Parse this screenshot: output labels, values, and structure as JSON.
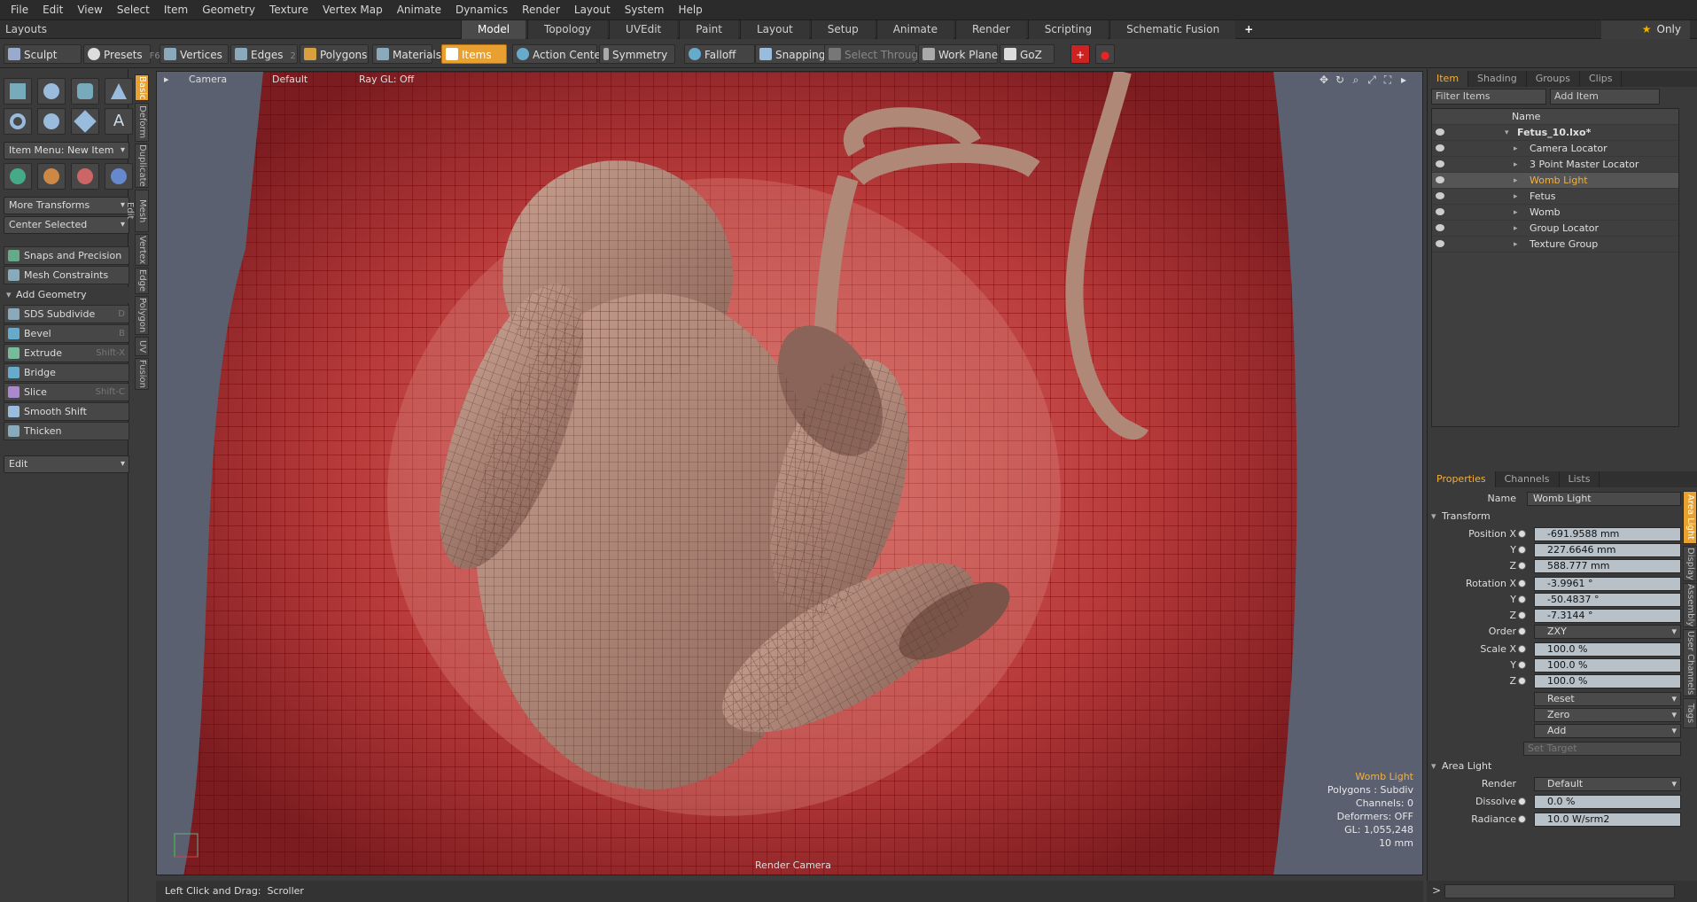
{
  "menu": [
    "File",
    "Edit",
    "View",
    "Select",
    "Item",
    "Geometry",
    "Texture",
    "Vertex Map",
    "Animate",
    "Dynamics",
    "Render",
    "Layout",
    "System",
    "Help"
  ],
  "layouts_label": "Layouts",
  "layout_tabs": [
    "Model",
    "Topology",
    "UVEdit",
    "Paint",
    "Layout",
    "Setup",
    "Animate",
    "Render",
    "Scripting",
    "Schematic Fusion"
  ],
  "add_tab": "+",
  "only_label": "Only",
  "toolbar": {
    "sculpt": "Sculpt",
    "presets": "Presets",
    "presets_key": "F6",
    "vertices": "Vertices",
    "vertices_key": "1",
    "edges": "Edges",
    "edges_key": "2",
    "polygons": "Polygons",
    "materials": "Materials",
    "items": "Items",
    "action_center": "Action Center",
    "symmetry": "Symmetry",
    "falloff": "Falloff",
    "snapping": "Snapping",
    "select_through": "Select Through",
    "work_plane": "Work Plane",
    "goz": "GoZ"
  },
  "left": {
    "item_menu": "Item Menu: New Item",
    "more_transforms": "More Transforms",
    "center_selected": "Center Selected",
    "snaps": "Snaps and Precision",
    "mesh_constraints": "Mesh Constraints",
    "add_geometry": "Add Geometry",
    "tools": [
      {
        "label": "SDS Subdivide",
        "key": "D"
      },
      {
        "label": "Bevel",
        "key": "B"
      },
      {
        "label": "Extrude",
        "key": "Shift-X"
      },
      {
        "label": "Bridge",
        "key": ""
      },
      {
        "label": "Slice",
        "key": "Shift-C"
      },
      {
        "label": "Smooth Shift",
        "key": ""
      },
      {
        "label": "Thicken",
        "key": ""
      }
    ],
    "edit_dd": "Edit"
  },
  "vtabs": [
    "Basic",
    "Deform",
    "Duplicate",
    "Mesh Edit",
    "Vertex",
    "Edge",
    "Polygon",
    "UV",
    "Fusion"
  ],
  "viewport": {
    "camera": "Camera",
    "shading": "Default",
    "raygl": "Ray GL: Off",
    "render_camera": "Render Camera",
    "info": {
      "name": "Womb Light",
      "polygons": "Polygons : Subdiv",
      "channels": "Channels: 0",
      "deformers": "Deformers: OFF",
      "gl": "GL: 1,055,248",
      "size": "10 mm"
    }
  },
  "right": {
    "tabs": [
      "Item",
      "Shading",
      "Groups",
      "Clips"
    ],
    "filter": "Filter Items",
    "add_item": "Add Item",
    "name_col": "Name",
    "items": [
      {
        "label": "Fetus_10.lxo*",
        "indent": 0,
        "bold": true,
        "sel": false
      },
      {
        "label": "Camera Locator",
        "indent": 1,
        "sel": false
      },
      {
        "label": "3 Point Master Locator",
        "indent": 1,
        "sel": false
      },
      {
        "label": "Womb Light",
        "indent": 1,
        "sel": true
      },
      {
        "label": "Fetus",
        "indent": 1,
        "sel": false
      },
      {
        "label": "Womb",
        "indent": 1,
        "sel": false
      },
      {
        "label": "Group Locator",
        "indent": 1,
        "sel": false
      },
      {
        "label": "Texture Group",
        "indent": 1,
        "sel": false
      }
    ],
    "prop_tabs": [
      "Properties",
      "Channels",
      "Lists"
    ],
    "props": {
      "name_lbl": "Name",
      "name_val": "Womb Light",
      "transform": "Transform",
      "pos_lbl": "Position X",
      "posx": "-691.9588 mm",
      "posy": "227.6646 mm",
      "posz": "588.777 mm",
      "rot_lbl": "Rotation X",
      "rotx": "-3.9961 °",
      "roty": "-50.4837 °",
      "rotz": "-7.3144 °",
      "order_lbl": "Order",
      "order": "ZXY",
      "scale_lbl": "Scale X",
      "sx": "100.0 %",
      "sy": "100.0 %",
      "sz": "100.0 %",
      "y": "Y",
      "z": "Z",
      "reset": "Reset",
      "zero": "Zero",
      "add": "Add",
      "set_target": "Set Target",
      "area_light": "Area Light",
      "render_lbl": "Render",
      "render": "Default",
      "dissolve_lbl": "Dissolve",
      "dissolve": "0.0 %",
      "radiance_lbl": "Radiance",
      "radiance": "10.0 W/srm2"
    },
    "side_tabs": [
      "Area Light",
      "Display",
      "Assembly",
      "User Channels",
      "Tags"
    ]
  },
  "status": {
    "label": "Left Click and Drag:",
    "value": "Scroller"
  }
}
